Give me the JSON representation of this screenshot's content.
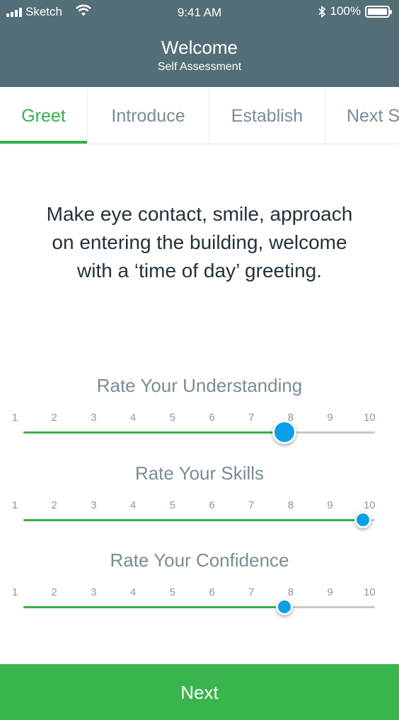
{
  "status_bar": {
    "carrier": "Sketch",
    "time": "9:41 AM",
    "battery": "100%"
  },
  "header": {
    "title": "Welcome",
    "subtitle": "Self Assessment"
  },
  "tabs": [
    {
      "label": "Greet",
      "active": true
    },
    {
      "label": "Introduce",
      "active": false
    },
    {
      "label": "Establish",
      "active": false
    },
    {
      "label": "Next S",
      "active": false
    }
  ],
  "prompt": {
    "line1": "Make eye contact, smile, approach",
    "line2": "on entering the building, welcome",
    "line3": "with a ‘time of day’ greeting."
  },
  "scale": [
    "1",
    "2",
    "3",
    "4",
    "5",
    "6",
    "7",
    "8",
    "9",
    "10"
  ],
  "ratings": [
    {
      "title": "Rate Your Understanding",
      "value": 8
    },
    {
      "title": "Rate Your Skills",
      "value": 10
    },
    {
      "title": "Rate Your Confidence",
      "value": 8
    }
  ],
  "next_button": {
    "label": "Next"
  },
  "colors": {
    "header": "#546e78",
    "accent": "#34b04b",
    "thumb": "#0aa0e6",
    "button": "#3ab44c"
  }
}
